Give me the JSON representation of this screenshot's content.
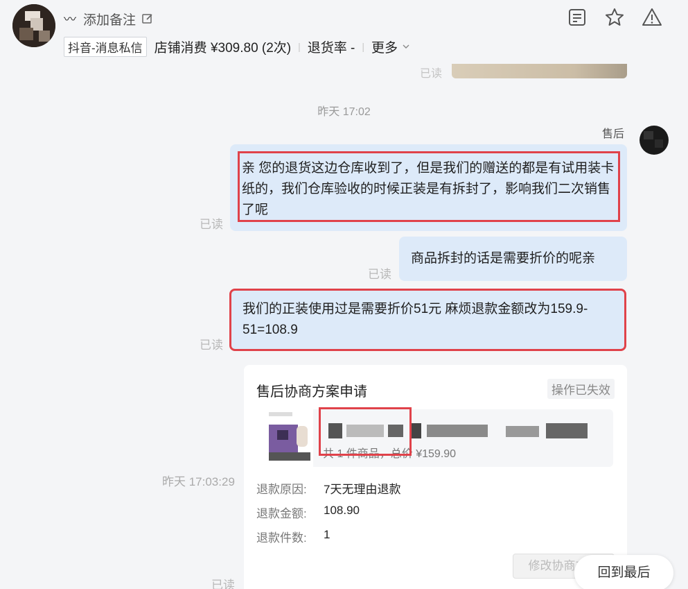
{
  "header": {
    "nickname": "〰",
    "remark_label": "添加备注",
    "source_tag": "抖音-消息私信",
    "shop_spend": "店铺消费 ¥309.80 (2次)",
    "return_rate": "退货率 -",
    "more_label": "更多"
  },
  "chat": {
    "prev_read": "已读",
    "timestamp": "昨天 17:02",
    "sender_label": "售后",
    "messages": [
      {
        "text": "亲  您的退货这边仓库收到了，但是我们的赠送的都是有试用装卡纸的，我们仓库验收的时候正装是有拆封了，影响我们二次销售了呢",
        "status": "已读",
        "highlighted": true
      },
      {
        "text": "商品拆封的话是需要折价的呢亲",
        "status": "已读",
        "highlighted": false
      },
      {
        "text": "我们的正装使用过是需要折价51元  麻烦退款金额改为159.9-51=108.9",
        "status": "已读",
        "highlighted": true
      }
    ],
    "card_time": "昨天 17:03:29",
    "card_read": "已读",
    "card": {
      "title": "售后协商方案申请",
      "status": "操作已失效",
      "product_meta": "共 1 件商品，总价 ¥159.90",
      "reason_label": "退款原因:",
      "reason_value": "7天无理由退款",
      "amount_label": "退款金额:",
      "amount_value": "108.90",
      "count_label": "退款件数:",
      "count_value": "1",
      "modify_button": "修改协商方案"
    },
    "back_to_latest": "回到最后"
  },
  "colors": {
    "bubble": "#ddeaf9",
    "highlight": "#e0424a",
    "background": "#f4f5f7"
  }
}
